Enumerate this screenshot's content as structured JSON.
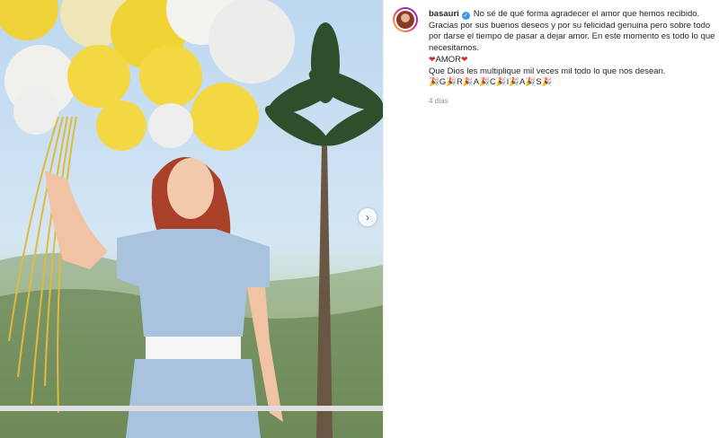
{
  "post": {
    "username": "basauri",
    "verified_icon": "verified-badge-icon",
    "caption_first": "No sé de qué forma agradecer el amor que hemos recibido.",
    "caption_second": "Gracias por sus buenos deseos y por su felicidad genuina pero sobre todo por darse el tiempo de pasar a dejar amor. En este momento es todo lo que necesitamos.",
    "heart": "❤",
    "amor": "AMOR",
    "caption_third": "Que Dios les multiplique mil veces mil todo lo que nos desean.",
    "gracias": "🎉G🎉R🎉A🎉C🎉I🎉A🎉S🎉",
    "time": "4 días"
  },
  "carousel": {
    "next_icon": "chevron-right-icon",
    "next_glyph": "›"
  },
  "colors": {
    "accent": "#3897f0",
    "balloon": "#f3d743",
    "dress": "#a9c3df",
    "hair": "#a8402a"
  }
}
